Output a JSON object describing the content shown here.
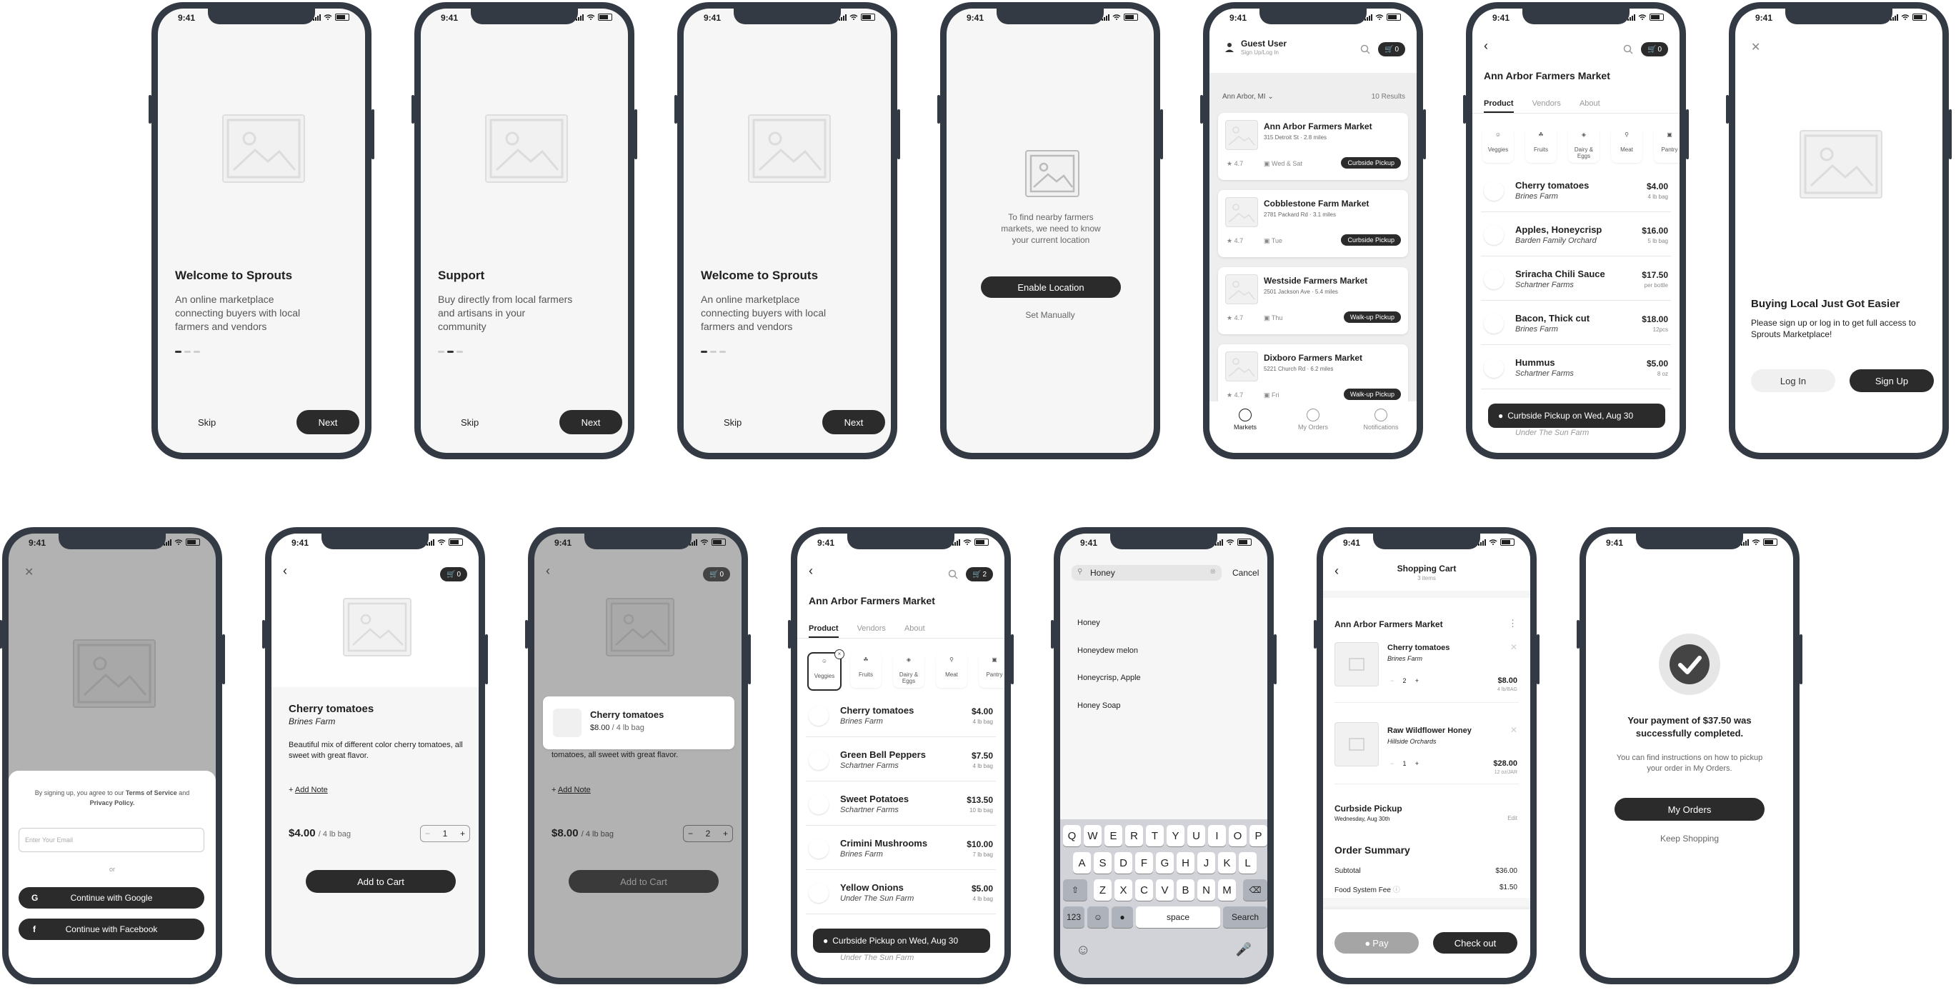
{
  "status_time": "9:41",
  "onboarding": [
    {
      "title": "Welcome to Sprouts",
      "body": "An online marketplace connecting buyers with local farmers and vendors",
      "skip": "Skip",
      "next": "Next"
    },
    {
      "title": "Support",
      "body": "Buy directly from local farmers and artisans in your community",
      "skip": "Skip",
      "next": "Next"
    },
    {
      "title": "Welcome to Sprouts",
      "body": "An online marketplace connecting buyers with local farmers and vendors",
      "skip": "Skip",
      "next": "Next"
    }
  ],
  "location": {
    "message": "To find nearby farmers markets, we need to know your current location",
    "enable": "Enable Location",
    "manual": "Set Manually"
  },
  "markets_screen": {
    "user_name": "Guest User",
    "user_sub": "Sign Up/Log In",
    "cart_count": "0",
    "location": "Ann Arbor, MI",
    "results": "10 Results",
    "markets": [
      {
        "name": "Ann Arbor Farmers Market",
        "address": "315 Detroit St",
        "distance": "2.8 miles",
        "rating": "4.7",
        "days": "Wed & Sat",
        "pickup": "Curbside Pickup"
      },
      {
        "name": "Cobblestone Farm Market",
        "address": "2781 Packard Rd",
        "distance": "3.1 miles",
        "rating": "4.7",
        "days": "Tue",
        "pickup": "Curbside Pickup"
      },
      {
        "name": "Westside Farmers Market",
        "address": "2501 Jackson Ave",
        "distance": "5.4 miles",
        "rating": "4.7",
        "days": "Thu",
        "pickup": "Walk-up Pickup"
      },
      {
        "name": "Dixboro Farmers Market",
        "address": "5221 Church Rd",
        "distance": "6.2 miles",
        "rating": "4.7",
        "days": "Fri",
        "pickup": "Walk-up Pickup"
      }
    ],
    "tabs": [
      "Markets",
      "My Orders",
      "Notifications"
    ]
  },
  "market_detail": {
    "title": "Ann Arbor Farmers Market",
    "cart_count": "0",
    "tabs": [
      "Product",
      "Vendors",
      "About"
    ],
    "categories": [
      "Veggies",
      "Fruits",
      "Dairy & Eggs",
      "Meat",
      "Pantry"
    ],
    "products": [
      {
        "name": "Cherry tomatoes",
        "vendor": "Brines Farm",
        "price": "$4.00",
        "unit": "4 lb bag"
      },
      {
        "name": "Apples, Honeycrisp",
        "vendor": "Barden Family Orchard",
        "price": "$16.00",
        "unit": "5 lb bag"
      },
      {
        "name": "Sriracha Chili Sauce",
        "vendor": "Schartner Farms",
        "price": "$17.50",
        "unit": "per bottle"
      },
      {
        "name": "Bacon, Thick cut",
        "vendor": "Brines Farm",
        "price": "$18.00",
        "unit": "12pcs"
      },
      {
        "name": "Hummus",
        "vendor": "Schartner Farms",
        "price": "$5.00",
        "unit": "8 oz"
      }
    ],
    "partial_vendor": "Under The Sun Farm",
    "pickup": "Curbside Pickup on Wed, Aug 30"
  },
  "signup_promo": {
    "title": "Buying Local Just Got Easier",
    "body": "Please sign up or log in to get full access to Sprouts Marketplace!",
    "login": "Log In",
    "signup": "Sign Up"
  },
  "signup_sheet": {
    "terms_pre": "By signing up, you agree to our",
    "terms": "Terms of Service",
    "and": "and",
    "privacy": "Privacy Policy.",
    "email_placeholder": "Enter Your Email",
    "or": "or",
    "google": "Continue with Google",
    "facebook": "Continue with Facebook"
  },
  "product_detail": {
    "cart_count": "0",
    "name": "Cherry tomatoes",
    "vendor": "Brines Farm",
    "desc": "Beautiful mix of different color cherry tomatoes, all sweet with great flavor.",
    "add_note": "Add Note",
    "price": "$4.00",
    "unit": "/ 4 lb bag",
    "qty": "1",
    "add_to_cart": "Add to Cart"
  },
  "product_added": {
    "cart_count": "0",
    "toast_name": "Cherry tomatoes",
    "toast_price": "$8.00",
    "toast_unit": "/ 4 lb bag",
    "desc_partial": "tomatoes, all sweet with great flavor.",
    "add_note": "Add Note",
    "price": "$8.00",
    "unit": "/ 4 lb bag",
    "qty": "2",
    "add_to_cart": "Add to Cart"
  },
  "veggies_list": {
    "title": "Ann Arbor Farmers Market",
    "cart_count": "2",
    "tabs": [
      "Product",
      "Vendors",
      "About"
    ],
    "categories": [
      "Veggies",
      "Fruits",
      "Dairy & Eggs",
      "Meat",
      "Pantry"
    ],
    "products": [
      {
        "name": "Cherry tomatoes",
        "vendor": "Brines Farm",
        "price": "$4.00",
        "unit": "4 lb bag"
      },
      {
        "name": "Green Bell Peppers",
        "vendor": "Schartner Farms",
        "price": "$7.50",
        "unit": "4 lb bag"
      },
      {
        "name": "Sweet Potatoes",
        "vendor": "Schartner Farms",
        "price": "$13.50",
        "unit": "10 lb bag"
      },
      {
        "name": "Crimini Mushrooms",
        "vendor": "Brines Farm",
        "price": "$10.00",
        "unit": "7 lb bag"
      },
      {
        "name": "Yellow Onions",
        "vendor": "Under The Sun Farm",
        "price": "$5.00",
        "unit": "4 lb bag"
      }
    ],
    "partial_vendor": "Under The Sun Farm",
    "pickup": "Curbside Pickup on Wed, Aug 30"
  },
  "search": {
    "query": "Honey",
    "cancel": "Cancel",
    "results": [
      "Honey",
      "Honeydew melon",
      "Honeycrisp, Apple",
      "Honey Soap"
    ],
    "keys_row1": [
      "Q",
      "W",
      "E",
      "R",
      "T",
      "Y",
      "U",
      "I",
      "O",
      "P"
    ],
    "keys_row2": [
      "A",
      "S",
      "D",
      "F",
      "G",
      "H",
      "J",
      "K",
      "L"
    ],
    "keys_row3": [
      "Z",
      "X",
      "C",
      "V",
      "B",
      "N",
      "M"
    ],
    "key_123": "123",
    "key_space": "space",
    "key_search": "Search"
  },
  "cart": {
    "title": "Shopping Cart",
    "subtitle": "3 items",
    "market": "Ann Arbor Farmers Market",
    "items": [
      {
        "name": "Cherry tomatoes",
        "vendor": "Brines Farm",
        "qty": "2",
        "price": "$8.00",
        "unit": "4 lb/BAG"
      },
      {
        "name": "Raw Wildflower Honey",
        "vendor": "Hillside Orchards",
        "qty": "1",
        "price": "$28.00",
        "unit": "12 oz/JAR"
      }
    ],
    "pickup_title": "Curbside Pickup",
    "pickup_date": "Wednesday, Aug 30th",
    "edit": "Edit",
    "summary_title": "Order Summary",
    "subtotal_label": "Subtotal",
    "subtotal": "$36.00",
    "fee_label": "Food System Fee",
    "fee": "$1.50",
    "pay": "Pay",
    "checkout": "Check out"
  },
  "success": {
    "title": "Your payment of $37.50 was successfully completed.",
    "body": "You can find instructions on how to pickup your order in My Orders.",
    "my_orders": "My Orders",
    "keep": "Keep Shopping"
  }
}
